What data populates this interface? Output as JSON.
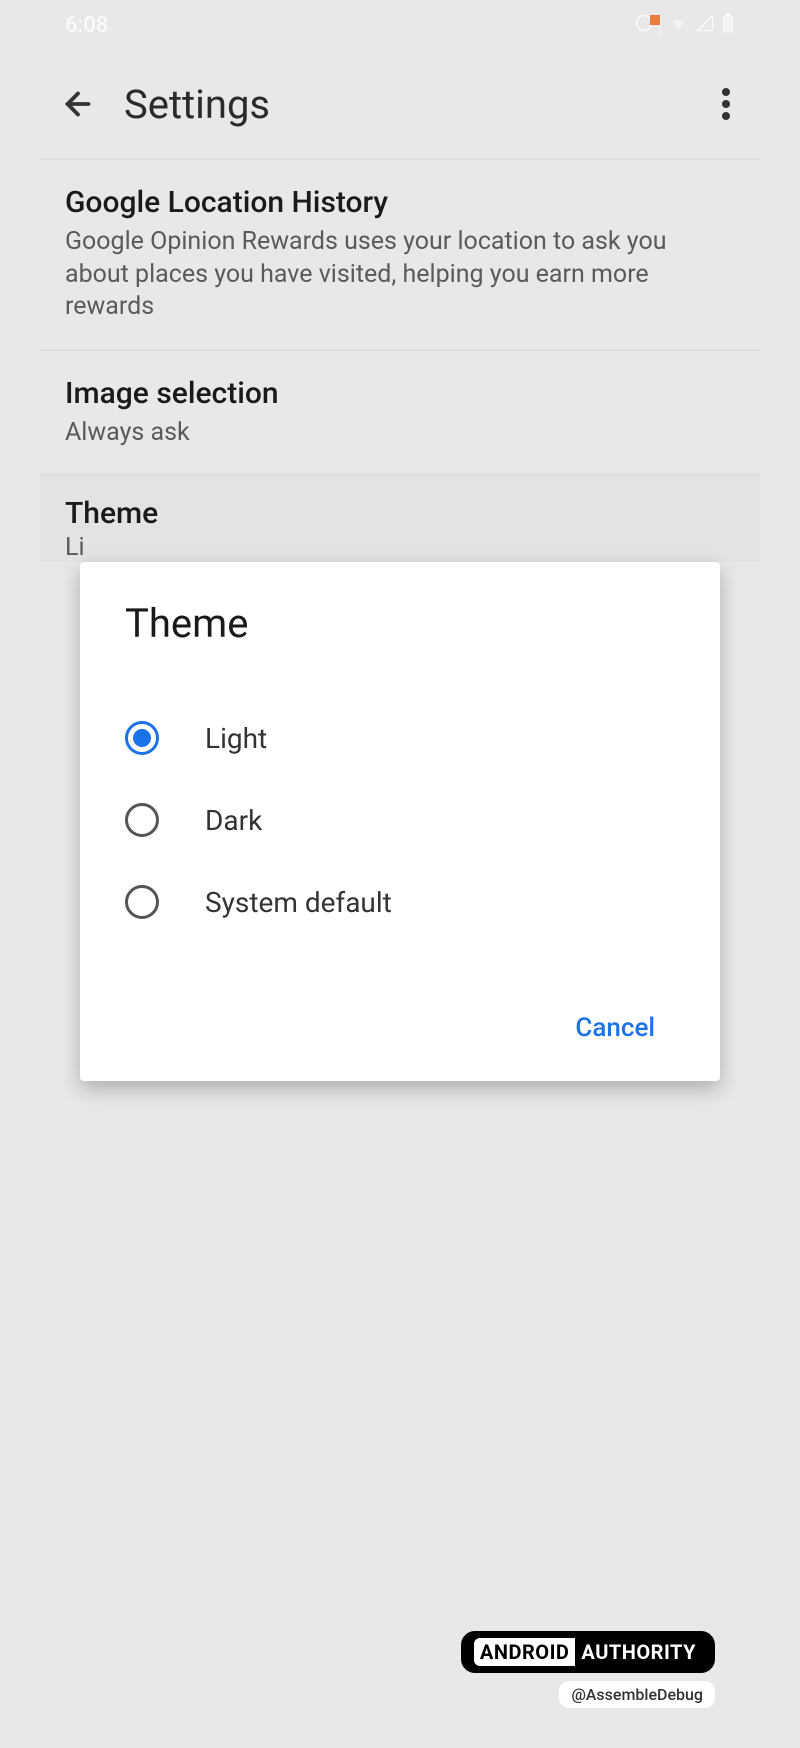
{
  "status": {
    "time": "6:08"
  },
  "header": {
    "title": "Settings"
  },
  "settings": {
    "locationHistory": {
      "title": "Google Location History",
      "description": "Google Opinion Rewards uses your location to ask you about places you have visited, helping you earn more rewards"
    },
    "imageSelection": {
      "title": "Image selection",
      "value": "Always ask"
    },
    "theme": {
      "title": "Theme",
      "valuePartial": "Li"
    }
  },
  "dialog": {
    "title": "Theme",
    "options": [
      {
        "label": "Light",
        "selected": true
      },
      {
        "label": "Dark",
        "selected": false
      },
      {
        "label": "System default",
        "selected": false
      }
    ],
    "cancel": "Cancel"
  },
  "watermark": {
    "brandLeft": "ANDROID",
    "brandRight": "AUTHORITY",
    "handle": "@AssembleDebug"
  }
}
